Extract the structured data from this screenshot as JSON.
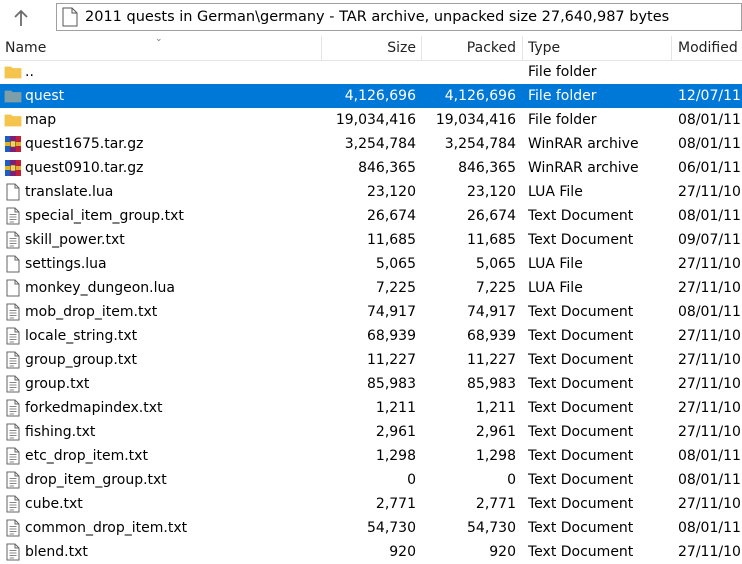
{
  "toolbar": {
    "path": "2011 quests in German\\germany - TAR archive, unpacked size 27,640,987 bytes"
  },
  "columns": {
    "name": "Name",
    "size": "Size",
    "packed": "Packed",
    "type": "Type",
    "modified": "Modified"
  },
  "files": [
    {
      "name": "..",
      "size": "",
      "packed": "",
      "type": "File folder",
      "modified": "",
      "icon": "folder-icon",
      "selected": false
    },
    {
      "name": "quest",
      "size": "4,126,696",
      "packed": "4,126,696",
      "type": "File folder",
      "modified": "12/07/11",
      "icon": "folder-icon",
      "selected": true
    },
    {
      "name": "map",
      "size": "19,034,416",
      "packed": "19,034,416",
      "type": "File folder",
      "modified": "08/01/11",
      "icon": "folder-icon",
      "selected": false
    },
    {
      "name": "quest1675.tar.gz",
      "size": "3,254,784",
      "packed": "3,254,784",
      "type": "WinRAR archive",
      "modified": "08/01/11",
      "icon": "winrar-icon",
      "selected": false
    },
    {
      "name": "quest0910.tar.gz",
      "size": "846,365",
      "packed": "846,365",
      "type": "WinRAR archive",
      "modified": "06/01/11",
      "icon": "winrar-icon",
      "selected": false
    },
    {
      "name": "translate.lua",
      "size": "23,120",
      "packed": "23,120",
      "type": "LUA File",
      "modified": "27/11/10",
      "icon": "blank-file-icon",
      "selected": false
    },
    {
      "name": "special_item_group.txt",
      "size": "26,674",
      "packed": "26,674",
      "type": "Text Document",
      "modified": "08/01/11",
      "icon": "text-file-icon",
      "selected": false
    },
    {
      "name": "skill_power.txt",
      "size": "11,685",
      "packed": "11,685",
      "type": "Text Document",
      "modified": "09/07/11",
      "icon": "text-file-icon",
      "selected": false
    },
    {
      "name": "settings.lua",
      "size": "5,065",
      "packed": "5,065",
      "type": "LUA File",
      "modified": "27/11/10",
      "icon": "blank-file-icon",
      "selected": false
    },
    {
      "name": "monkey_dungeon.lua",
      "size": "7,225",
      "packed": "7,225",
      "type": "LUA File",
      "modified": "27/11/10",
      "icon": "blank-file-icon",
      "selected": false
    },
    {
      "name": "mob_drop_item.txt",
      "size": "74,917",
      "packed": "74,917",
      "type": "Text Document",
      "modified": "08/01/11",
      "icon": "text-file-icon",
      "selected": false
    },
    {
      "name": "locale_string.txt",
      "size": "68,939",
      "packed": "68,939",
      "type": "Text Document",
      "modified": "27/11/10",
      "icon": "text-file-icon",
      "selected": false
    },
    {
      "name": "group_group.txt",
      "size": "11,227",
      "packed": "11,227",
      "type": "Text Document",
      "modified": "27/11/10",
      "icon": "text-file-icon",
      "selected": false
    },
    {
      "name": "group.txt",
      "size": "85,983",
      "packed": "85,983",
      "type": "Text Document",
      "modified": "27/11/10",
      "icon": "text-file-icon",
      "selected": false
    },
    {
      "name": "forkedmapindex.txt",
      "size": "1,211",
      "packed": "1,211",
      "type": "Text Document",
      "modified": "27/11/10",
      "icon": "text-file-icon",
      "selected": false
    },
    {
      "name": "fishing.txt",
      "size": "2,961",
      "packed": "2,961",
      "type": "Text Document",
      "modified": "27/11/10",
      "icon": "text-file-icon",
      "selected": false
    },
    {
      "name": "etc_drop_item.txt",
      "size": "1,298",
      "packed": "1,298",
      "type": "Text Document",
      "modified": "08/01/11",
      "icon": "text-file-icon",
      "selected": false
    },
    {
      "name": "drop_item_group.txt",
      "size": "0",
      "packed": "0",
      "type": "Text Document",
      "modified": "08/01/11",
      "icon": "text-file-icon",
      "selected": false
    },
    {
      "name": "cube.txt",
      "size": "2,771",
      "packed": "2,771",
      "type": "Text Document",
      "modified": "27/11/10",
      "icon": "text-file-icon",
      "selected": false
    },
    {
      "name": "common_drop_item.txt",
      "size": "54,730",
      "packed": "54,730",
      "type": "Text Document",
      "modified": "08/01/11",
      "icon": "text-file-icon",
      "selected": false
    },
    {
      "name": "blend.txt",
      "size": "920",
      "packed": "920",
      "type": "Text Document",
      "modified": "27/11/10",
      "icon": "text-file-icon",
      "selected": false
    }
  ],
  "colors": {
    "selection": "#0078d7",
    "folder": "#f4c44e",
    "folder_selected": "#7f9fa8"
  }
}
